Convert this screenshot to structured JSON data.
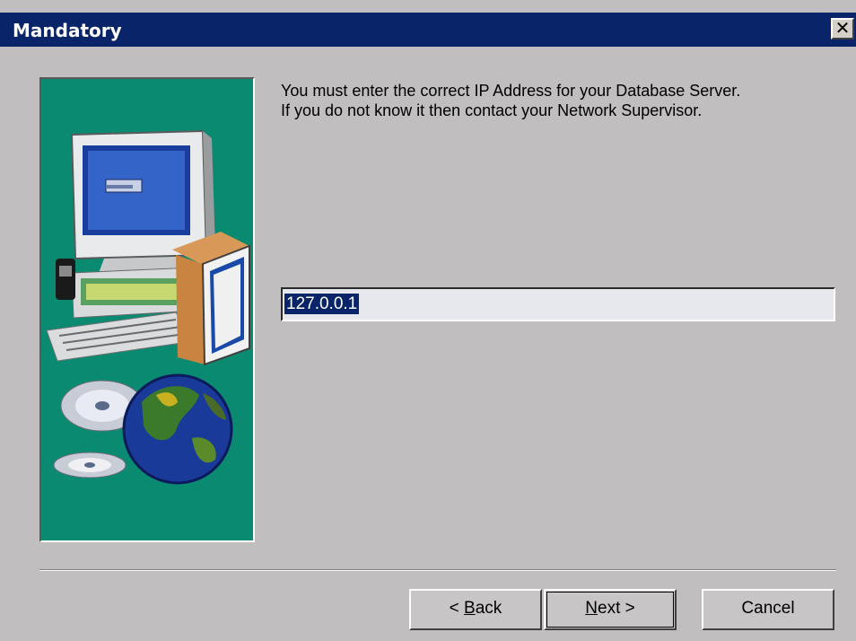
{
  "window": {
    "title": "Mandatory",
    "close_glyph": "✕"
  },
  "message": {
    "line1": "You must enter the correct IP Address for your Database Server.",
    "line2": "If you do not know it then contact your Network Supervisor."
  },
  "ip_field": {
    "value": "127.0.0.1",
    "selected": true
  },
  "buttons": {
    "back": {
      "prefix": "< ",
      "mnemonic": "B",
      "rest": "ack"
    },
    "next": {
      "mnemonic": "N",
      "rest": "ext >"
    },
    "cancel": {
      "label": "Cancel"
    }
  },
  "art": {
    "icons": [
      "computer-monitor-icon",
      "keyboard-icon",
      "software-box-icon",
      "cd-disc-icon",
      "globe-icon"
    ]
  },
  "colors": {
    "title_bar": "#0a246a",
    "art_background": "#0b8a72",
    "dialog_background": "#c0bebe",
    "selection": "#0a246a"
  }
}
